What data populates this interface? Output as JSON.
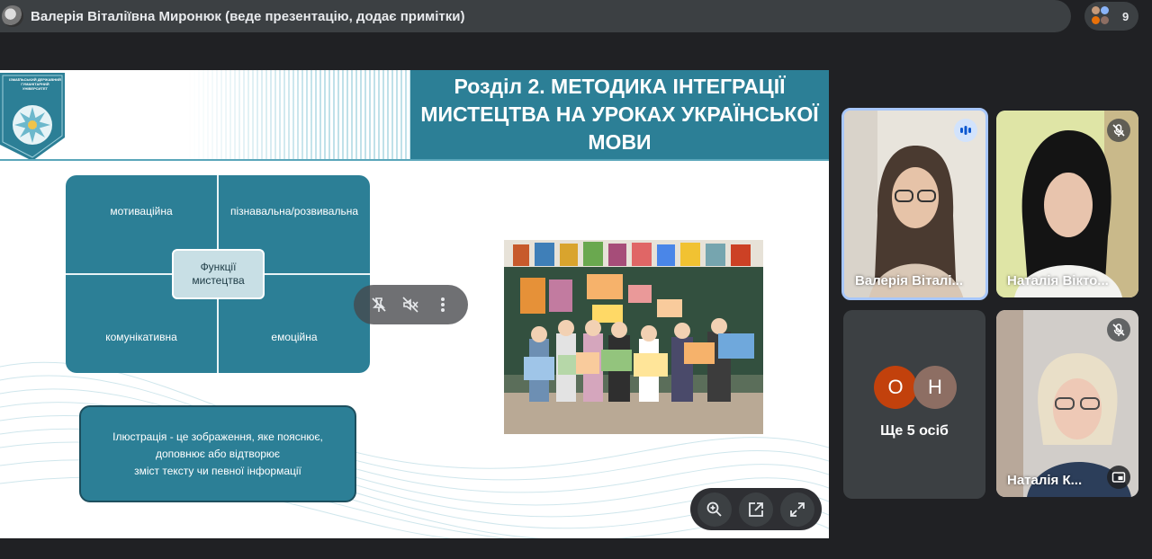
{
  "header": {
    "presenter_title": "Валерія Віталіївна Миронюк (веде презентацію, додає примітки)",
    "people_count": "9"
  },
  "slide": {
    "logo_caption": "ІЗМАЇЛЬСЬКИЙ ДЕРЖАВНИЙ ГУМАНІТАРНИЙ УНІВЕРСИТЕТ",
    "title": "Розділ 2. МЕТОДИКА ІНТЕГРАЦІЇ\nМИСТЕЦТВА НА УРОКАХ УКРАЇНСЬКОЇ\nМОВИ",
    "functions": {
      "top_left": "мотиваційна",
      "top_right": "пізнавальна/розвивальна",
      "bottom_left": "комунікативна",
      "bottom_right": "емоційна",
      "center": "Функції\nмистецтва"
    },
    "definition": "Ілюстрація - це зображення, яке пояснює,\nдоповнює або відтворює\nзміст тексту чи певної інформації",
    "colors": {
      "accent": "#2c7f96",
      "accent_light": "#c8dfe5"
    }
  },
  "overlay_controls": {
    "icons": [
      "unpin-icon",
      "mute-icon",
      "more-vert-icon"
    ]
  },
  "zoom_controls": {
    "icons": [
      "zoom-in-icon",
      "open-external-icon",
      "fullscreen-icon"
    ]
  },
  "participants": [
    {
      "name": "Валерія Віталі...",
      "state": "speaking"
    },
    {
      "name": "Наталія Вікто...",
      "state": "muted"
    },
    {
      "more_label": "Ще 5 осіб",
      "avatars": [
        "О",
        "Н"
      ]
    },
    {
      "name": "Наталія К...",
      "state": "muted"
    }
  ],
  "colors": {
    "background": "#202124",
    "tile": "#3c4043",
    "speaking_border": "#a8c7fa",
    "avatar_o": "#c2410c",
    "avatar_n": "#8d6e63"
  }
}
